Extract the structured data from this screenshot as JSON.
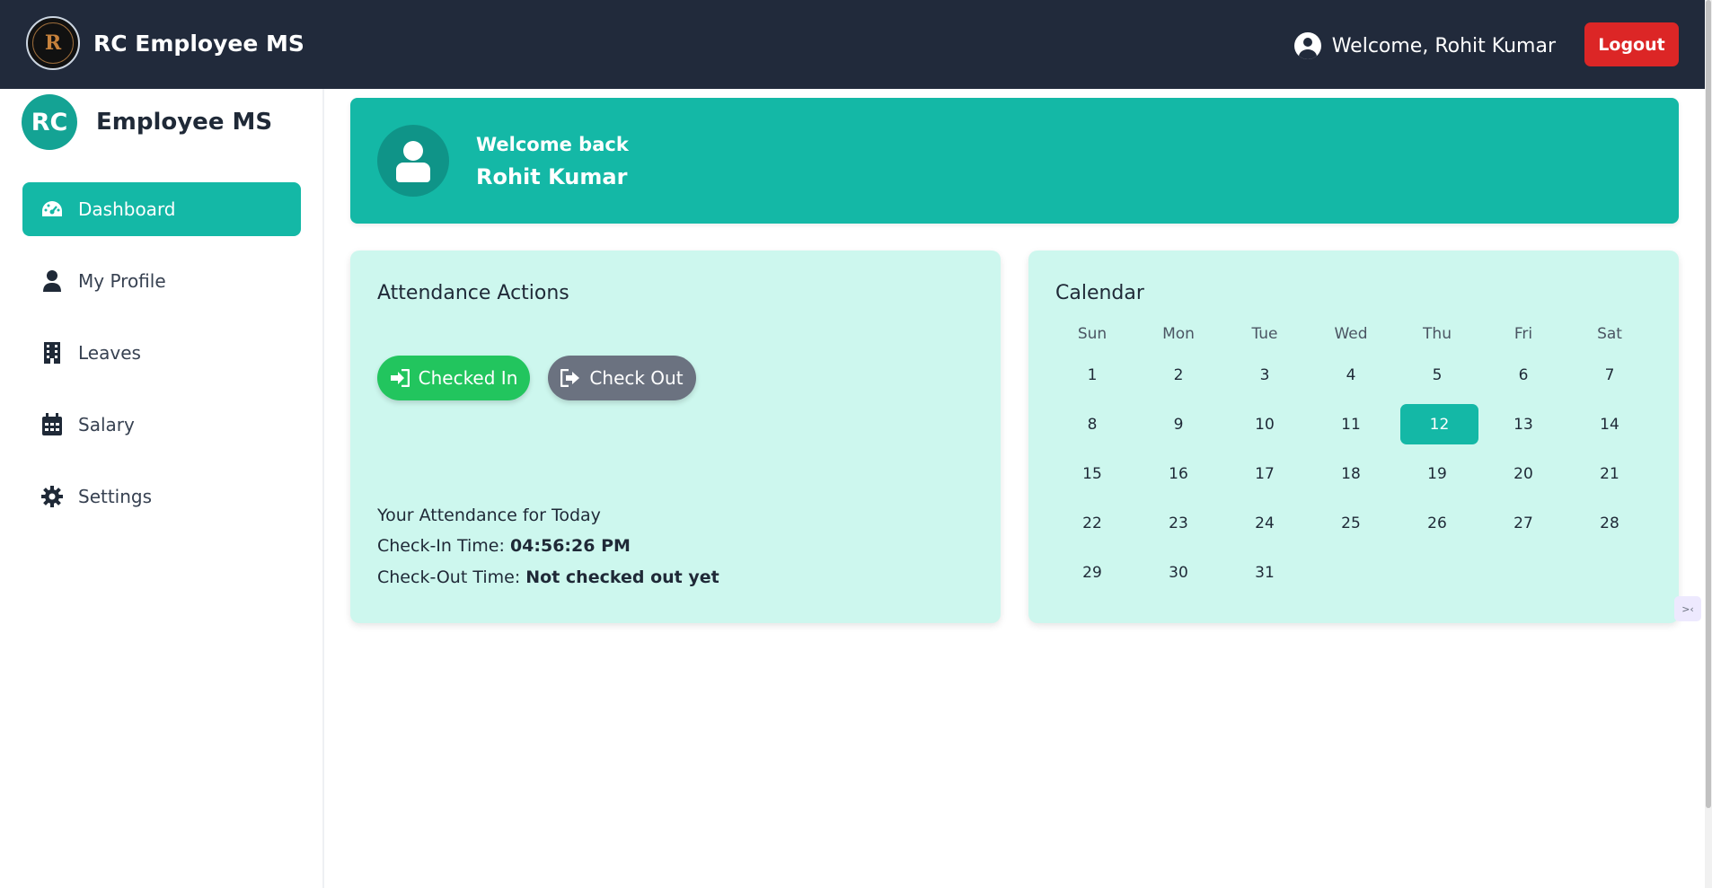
{
  "app": {
    "title": "RC Employee MS",
    "logo_letter": "R",
    "welcome": "Welcome, Rohit Kumar",
    "logout": "Logout"
  },
  "sidebar": {
    "avatar": "RC",
    "title": "Employee MS",
    "items": [
      {
        "label": "Dashboard",
        "icon": "dashboard-icon",
        "active": true
      },
      {
        "label": "My Profile",
        "icon": "user-icon",
        "active": false
      },
      {
        "label": "Leaves",
        "icon": "building-icon",
        "active": false
      },
      {
        "label": "Salary",
        "icon": "calendar-icon",
        "active": false
      },
      {
        "label": "Settings",
        "icon": "gear-icon",
        "active": false
      }
    ]
  },
  "banner": {
    "subtitle": "Welcome back",
    "name": "Rohit Kumar"
  },
  "attendance": {
    "title": "Attendance Actions",
    "checkin_label": "Checked In",
    "checkout_label": "Check Out",
    "today_heading": "Your Attendance for Today",
    "checkin_prefix": "Check-In Time: ",
    "checkin_value": "04:56:26 PM",
    "checkout_prefix": "Check-Out Time: ",
    "checkout_value": "Not checked out yet"
  },
  "calendar": {
    "title": "Calendar",
    "weekdays": [
      "Sun",
      "Mon",
      "Tue",
      "Wed",
      "Thu",
      "Fri",
      "Sat"
    ],
    "days": [
      "1",
      "2",
      "3",
      "4",
      "5",
      "6",
      "7",
      "8",
      "9",
      "10",
      "11",
      "12",
      "13",
      "14",
      "15",
      "16",
      "17",
      "18",
      "19",
      "20",
      "21",
      "22",
      "23",
      "24",
      "25",
      "26",
      "27",
      "28",
      "29",
      "30",
      "31"
    ],
    "today": "12"
  },
  "colors": {
    "topbar": "#212a3b",
    "accent": "#14b8a6",
    "card_bg": "#cdf7ee",
    "logout": "#dc2626",
    "checkin": "#22c55e",
    "checkout": "#6b7280"
  }
}
